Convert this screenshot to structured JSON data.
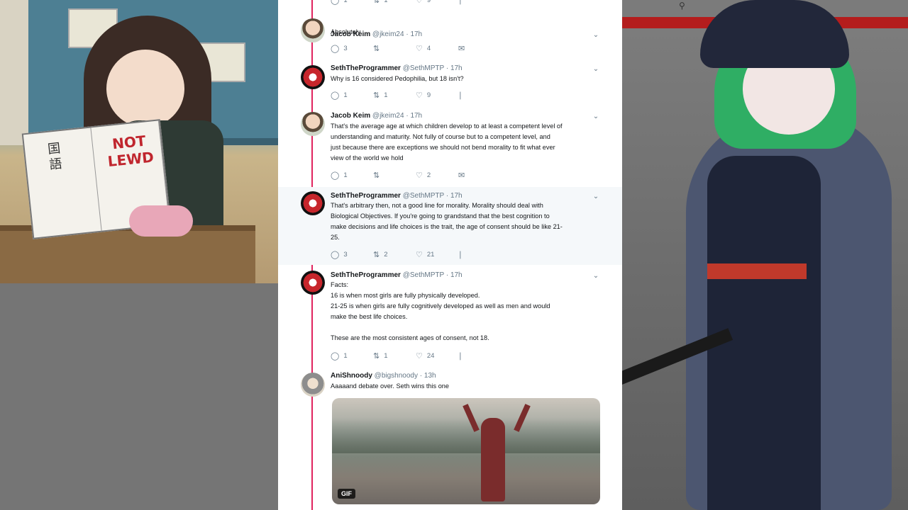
{
  "left_art": {
    "book_stamp": "NOT LEWD",
    "book_kanji": "国語"
  },
  "tweets": [
    {
      "id": "t0",
      "actions": {
        "replies": "1",
        "retweets": "1",
        "likes": "9"
      }
    },
    {
      "id": "t1",
      "name": "Jacob Keim",
      "handle": "@jkeim24",
      "time": "17h",
      "text": "Absolutely",
      "actions": {
        "replies": "3",
        "retweets": "",
        "likes": "4"
      }
    },
    {
      "id": "t2",
      "name": "SethTheProgrammer",
      "handle": "@SethMPTP",
      "time": "17h",
      "text": "Why is 16 considered Pedophilia, but 18 isn't?",
      "actions": {
        "replies": "1",
        "retweets": "1",
        "likes": "9"
      }
    },
    {
      "id": "t3",
      "name": "Jacob Keim",
      "handle": "@jkeim24",
      "time": "17h",
      "text": "That's the average age at which children develop to at least a competent level of\nunderstanding and maturity. Not fully of course but to a competent level, and\njust because there are exceptions we should not bend morality to fit what ever\nview of the world we hold",
      "actions": {
        "replies": "1",
        "retweets": "",
        "likes": "2"
      }
    },
    {
      "id": "t4",
      "name": "SethTheProgrammer",
      "handle": "@SethMPTP",
      "time": "17h",
      "text": "That's arbitrary then, not a good line for morality.  Morality should deal with\nBiological Objectives.  If you're going to grandstand that the best cognition to\nmake decisions and life choices is the trait, the age of consent should be like 21-\n25.",
      "actions": {
        "replies": "3",
        "retweets": "2",
        "likes": "21"
      }
    },
    {
      "id": "t5",
      "name": "SethTheProgrammer",
      "handle": "@SethMPTP",
      "time": "17h",
      "text": "Facts:\n16 is when most girls are fully physically developed.\n21-25 is when girls are fully cognitively developed as well as men and would\nmake the best life choices.\n\nThese are the most consistent ages of consent, not 18.",
      "actions": {
        "replies": "1",
        "retweets": "1",
        "likes": "24"
      }
    },
    {
      "id": "t6",
      "name": "AniShnoody",
      "handle": "@bigshnoody",
      "time": "13h",
      "text": "Aaaaand debate over. Seth wins this one",
      "media_badge": "GIF"
    }
  ],
  "icons": {
    "reply": "reply-icon",
    "retweet": "retweet-icon",
    "like": "heart-icon",
    "message": "envelope-icon",
    "analytics": "analytics-icon",
    "caret": "chevron-down-icon",
    "search": "search-icon"
  },
  "colors": {
    "thread_line": "#e0245e",
    "meta_text": "#657786",
    "browser_accent": "#b41d1d"
  }
}
